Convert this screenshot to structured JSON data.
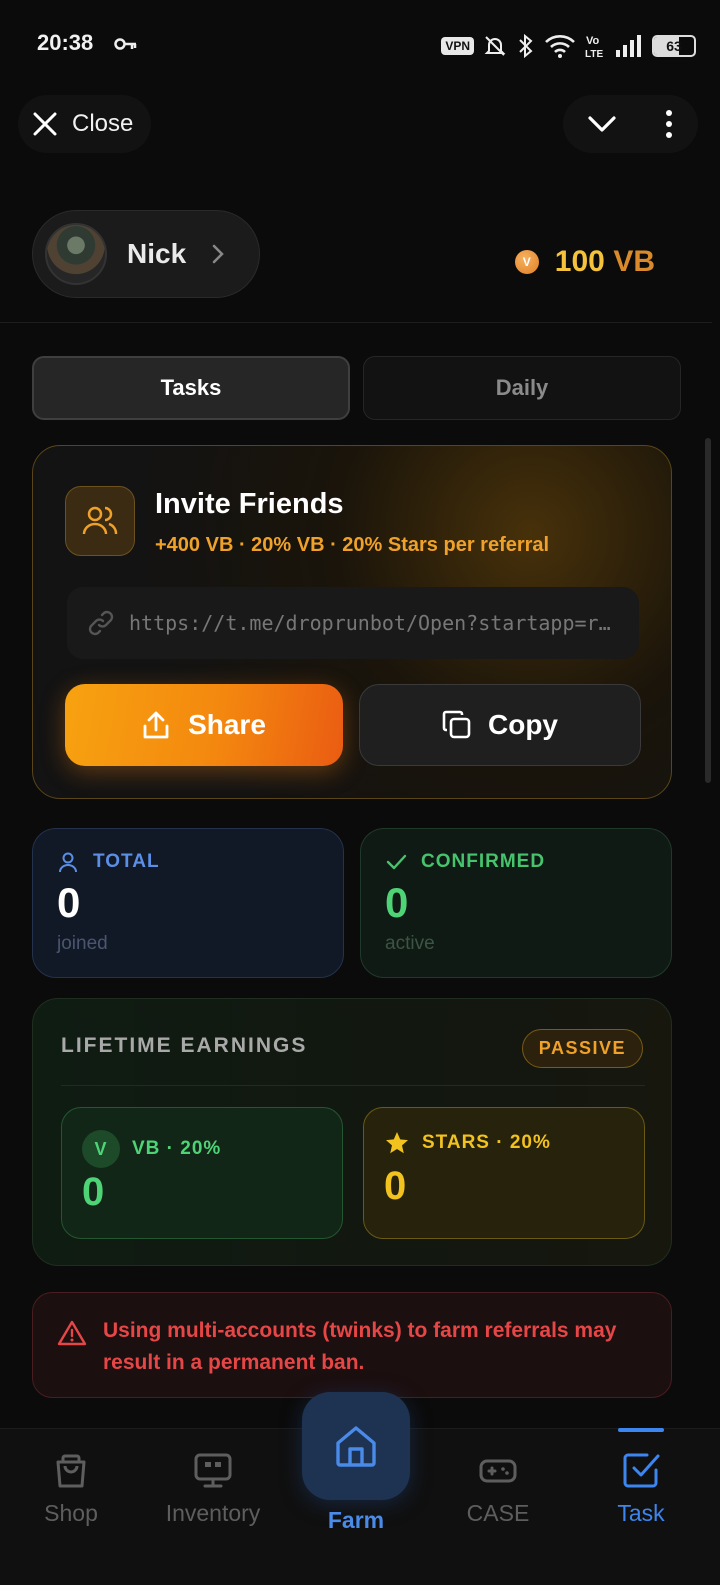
{
  "status_bar": {
    "time": "20:38",
    "vpn": "VPN",
    "battery": "63",
    "icons": [
      "key-icon",
      "vpn-icon",
      "mute-icon",
      "bluetooth-icon",
      "wifi-icon",
      "volte-icon",
      "signal-icon",
      "battery-icon"
    ]
  },
  "top_nav": {
    "close_label": "Close"
  },
  "profile": {
    "name": "Nick"
  },
  "balance": {
    "amount": "100",
    "unit": "VB",
    "coin_letter": "V"
  },
  "tabs": [
    {
      "label": "Tasks",
      "active": true
    },
    {
      "label": "Daily",
      "active": false
    }
  ],
  "invite": {
    "title": "Invite Friends",
    "subtitle": "+400 VB · 20% VB · 20% Stars per referral",
    "link": "https://t.me/droprunbot/Open?startapp=ref",
    "share_label": "Share",
    "copy_label": "Copy"
  },
  "stats": {
    "total": {
      "label": "TOTAL",
      "value": "0",
      "foot": "joined"
    },
    "confirmed": {
      "label": "CONFIRMED",
      "value": "0",
      "foot": "active"
    }
  },
  "lifetime": {
    "title": "LIFETIME EARNINGS",
    "badge": "PASSIVE",
    "vb": {
      "icon_letter": "V",
      "label": "VB · 20%",
      "value": "0"
    },
    "stars": {
      "label": "STARS · 20%",
      "value": "0"
    }
  },
  "warning": {
    "text": "Using multi-accounts (twinks) to farm referrals may result in a permanent ban."
  },
  "bottom_nav": {
    "shop": "Shop",
    "inventory": "Inventory",
    "farm": "Farm",
    "case": "CASE",
    "task": "Task"
  },
  "colors": {
    "accent_orange": "#f4880f",
    "accent_gold": "#f5c23b",
    "accent_blue": "#3d86f0",
    "green": "#4fd377",
    "danger": "#e64646"
  }
}
